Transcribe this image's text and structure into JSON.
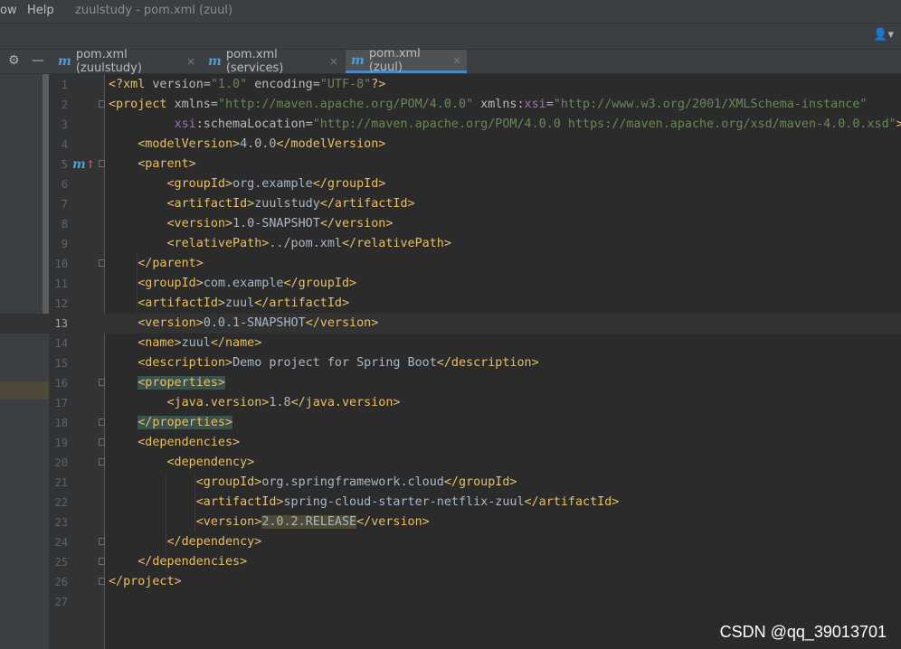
{
  "menu": {
    "items": [
      "ow",
      "Help"
    ],
    "title": "zuulstudy - pom.xml (zuul)"
  },
  "toolbar": {
    "user_button": "👤▾"
  },
  "tools": {
    "gear": "⚙",
    "minimize": "—"
  },
  "tabs": [
    {
      "label": "pom.xml (zuulstudy)",
      "active": false
    },
    {
      "label": "pom.xml (services)",
      "active": false
    },
    {
      "label": "pom.xml (zuul)",
      "active": true
    }
  ],
  "tab_close_glyph": "×",
  "maven_glyph": "m",
  "caret_line": 13,
  "colors": {
    "tag": "#e8bf6a",
    "attr": "#bababa",
    "value": "#6a8759",
    "text": "#a9b7c6",
    "ns": "#9876aa",
    "bracket_match": "#3b514d",
    "todo_hl": "#4e4a36",
    "accent": "#4a88c7"
  },
  "code_lines": [
    {
      "n": "1",
      "tokens": [
        [
          "<?xml ",
          "t"
        ],
        [
          "version",
          "a"
        ],
        [
          "=",
          "x"
        ],
        [
          "\"1.0\"",
          "v"
        ],
        [
          " ",
          "x"
        ],
        [
          "encoding",
          "a"
        ],
        [
          "=",
          "x"
        ],
        [
          "\"UTF-8\"",
          "v"
        ],
        [
          "?>",
          "t"
        ]
      ]
    },
    {
      "n": "2",
      "fold": true,
      "tokens": [
        [
          "<project ",
          "t"
        ],
        [
          "xmlns",
          "a"
        ],
        [
          "=",
          "x"
        ],
        [
          "\"http://maven.apache.org/POM/4.0.0\"",
          "v"
        ],
        [
          " ",
          "x"
        ],
        [
          "xmlns:",
          "a"
        ],
        [
          "xsi",
          "n"
        ],
        [
          "=",
          "x"
        ],
        [
          "\"http://www.w3.org/2001/XMLSchema-instance\"",
          "v"
        ]
      ]
    },
    {
      "n": "3",
      "tokens": [
        [
          "         ",
          "x"
        ],
        [
          "xsi",
          "n"
        ],
        [
          ":schemaLocation",
          "a"
        ],
        [
          "=",
          "x"
        ],
        [
          "\"http://maven.apache.org/POM/4.0.0 https://maven.apache.org/xsd/maven-4.0.0.xsd\"",
          "v"
        ],
        [
          ">",
          "t"
        ]
      ]
    },
    {
      "n": "4",
      "tokens": [
        [
          "    ",
          "x"
        ],
        [
          "<modelVersion>",
          "t"
        ],
        [
          "4.0.0",
          "x"
        ],
        [
          "</modelVersion>",
          "t"
        ]
      ]
    },
    {
      "n": "5",
      "fold": true,
      "mark": true,
      "tokens": [
        [
          "    ",
          "x"
        ],
        [
          "<parent>",
          "t"
        ]
      ]
    },
    {
      "n": "6",
      "tokens": [
        [
          "        ",
          "x"
        ],
        [
          "<groupId>",
          "t"
        ],
        [
          "org.example",
          "x"
        ],
        [
          "</groupId>",
          "t"
        ]
      ]
    },
    {
      "n": "7",
      "tokens": [
        [
          "        ",
          "x"
        ],
        [
          "<artifactId>",
          "t"
        ],
        [
          "zuulstudy",
          "x"
        ],
        [
          "</artifactId>",
          "t"
        ]
      ]
    },
    {
      "n": "8",
      "tokens": [
        [
          "        ",
          "x"
        ],
        [
          "<version>",
          "t"
        ],
        [
          "1.0-SNAPSHOT",
          "x"
        ],
        [
          "</version>",
          "t"
        ]
      ]
    },
    {
      "n": "9",
      "tokens": [
        [
          "        ",
          "x"
        ],
        [
          "<relativePath>",
          "t"
        ],
        [
          "../pom.xml",
          "x"
        ],
        [
          "</relativePath>",
          "t"
        ]
      ]
    },
    {
      "n": "10",
      "fold": true,
      "tokens": [
        [
          "    ",
          "x"
        ],
        [
          "</parent>",
          "t"
        ]
      ]
    },
    {
      "n": "11",
      "tokens": [
        [
          "    ",
          "x"
        ],
        [
          "<groupId>",
          "t"
        ],
        [
          "com.example",
          "x"
        ],
        [
          "</groupId>",
          "t"
        ]
      ]
    },
    {
      "n": "12",
      "tokens": [
        [
          "    ",
          "x"
        ],
        [
          "<artifactId>",
          "t"
        ],
        [
          "zuul",
          "x"
        ],
        [
          "</artifactId>",
          "t"
        ]
      ]
    },
    {
      "n": "13",
      "tokens": [
        [
          "    ",
          "x"
        ],
        [
          "<version>",
          "t"
        ],
        [
          "0.0.1-SNAPSHOT",
          "x"
        ],
        [
          "</version>",
          "t"
        ]
      ]
    },
    {
      "n": "14",
      "tokens": [
        [
          "    ",
          "x"
        ],
        [
          "<name>",
          "t"
        ],
        [
          "zuul",
          "x"
        ],
        [
          "</name>",
          "t"
        ]
      ]
    },
    {
      "n": "15",
      "tokens": [
        [
          "    ",
          "x"
        ],
        [
          "<description>",
          "t"
        ],
        [
          "Demo project for Spring Boot",
          "x"
        ],
        [
          "</description>",
          "t"
        ]
      ]
    },
    {
      "n": "16",
      "fold": true,
      "tokens": [
        [
          "    ",
          "x"
        ],
        [
          "<properties>",
          "tm"
        ]
      ]
    },
    {
      "n": "17",
      "tokens": [
        [
          "        ",
          "x"
        ],
        [
          "<java.version>",
          "t"
        ],
        [
          "1.8",
          "x"
        ],
        [
          "</java.version>",
          "t"
        ]
      ]
    },
    {
      "n": "18",
      "fold": true,
      "tokens": [
        [
          "    ",
          "x"
        ],
        [
          "</properties>",
          "tm"
        ]
      ]
    },
    {
      "n": "19",
      "fold": true,
      "tokens": [
        [
          "    ",
          "x"
        ],
        [
          "<dependencies>",
          "t"
        ]
      ]
    },
    {
      "n": "20",
      "fold": true,
      "tokens": [
        [
          "        ",
          "x"
        ],
        [
          "<dependency>",
          "t"
        ]
      ]
    },
    {
      "n": "21",
      "tokens": [
        [
          "            ",
          "x"
        ],
        [
          "<groupId>",
          "t"
        ],
        [
          "org.springframework.cloud",
          "x"
        ],
        [
          "</groupId>",
          "t"
        ]
      ]
    },
    {
      "n": "22",
      "tokens": [
        [
          "            ",
          "x"
        ],
        [
          "<artifactId>",
          "t"
        ],
        [
          "spring-cloud-starter-netflix-zuul",
          "x"
        ],
        [
          "</artifactId>",
          "t"
        ]
      ]
    },
    {
      "n": "23",
      "tokens": [
        [
          "            ",
          "x"
        ],
        [
          "<version>",
          "t"
        ],
        [
          "2.0.2.RELEASE",
          "h"
        ],
        [
          "</version>",
          "t"
        ]
      ]
    },
    {
      "n": "24",
      "fold": true,
      "tokens": [
        [
          "        ",
          "x"
        ],
        [
          "</dependency>",
          "t"
        ]
      ]
    },
    {
      "n": "25",
      "fold": true,
      "tokens": [
        [
          "    ",
          "x"
        ],
        [
          "</dependencies>",
          "t"
        ]
      ]
    },
    {
      "n": "26",
      "fold": true,
      "tokens": [
        [
          "</project>",
          "t"
        ]
      ]
    },
    {
      "n": "27",
      "tokens": []
    }
  ],
  "watermark": "CSDN @qq_39013701"
}
